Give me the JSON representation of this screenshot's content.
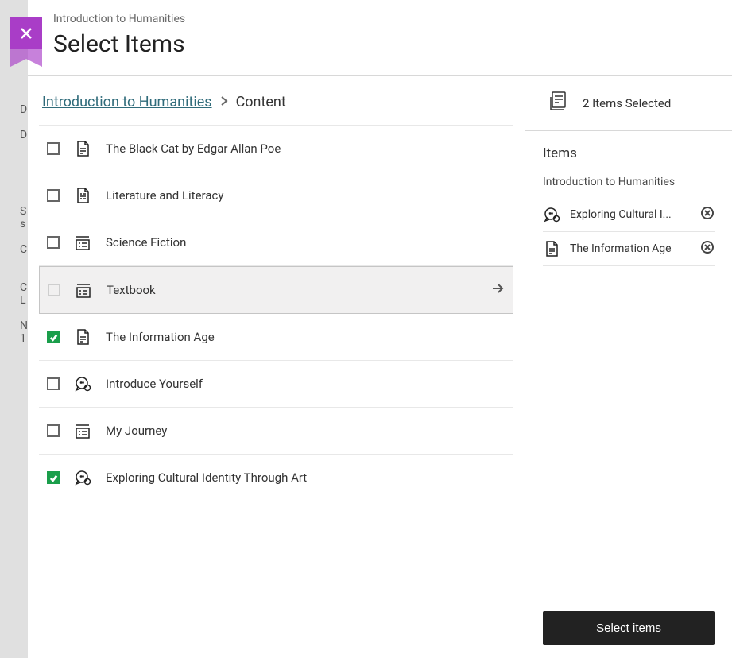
{
  "header": {
    "breadcrumb": "Introduction to Humanities",
    "title": "Select Items"
  },
  "nav": {
    "parent": "Introduction to Humanities",
    "current": "Content"
  },
  "items": [
    {
      "label": "The Black Cat by Edgar Allan Poe",
      "icon": "document",
      "checked": false,
      "folder": false
    },
    {
      "label": "Literature and Literacy",
      "icon": "document-lines",
      "checked": false,
      "folder": false
    },
    {
      "label": "Science Fiction",
      "icon": "list",
      "checked": false,
      "folder": false
    },
    {
      "label": "Textbook",
      "icon": "list",
      "checked": false,
      "folder": true,
      "highlighted": true
    },
    {
      "label": "The Information Age",
      "icon": "document",
      "checked": true,
      "folder": false
    },
    {
      "label": "Introduce Yourself",
      "icon": "discussion",
      "checked": false,
      "folder": false
    },
    {
      "label": "My Journey",
      "icon": "list",
      "checked": false,
      "folder": false
    },
    {
      "label": "Exploring Cultural Identity Through Art",
      "icon": "discussion",
      "checked": true,
      "folder": false
    }
  ],
  "selection": {
    "count_label": "2 Items Selected",
    "heading": "Items",
    "group": "Introduction to Humanities",
    "items": [
      {
        "label": "Exploring Cultural I...",
        "icon": "discussion"
      },
      {
        "label": "The Information Age",
        "icon": "document"
      }
    ]
  },
  "footer": {
    "select_label": "Select items"
  }
}
